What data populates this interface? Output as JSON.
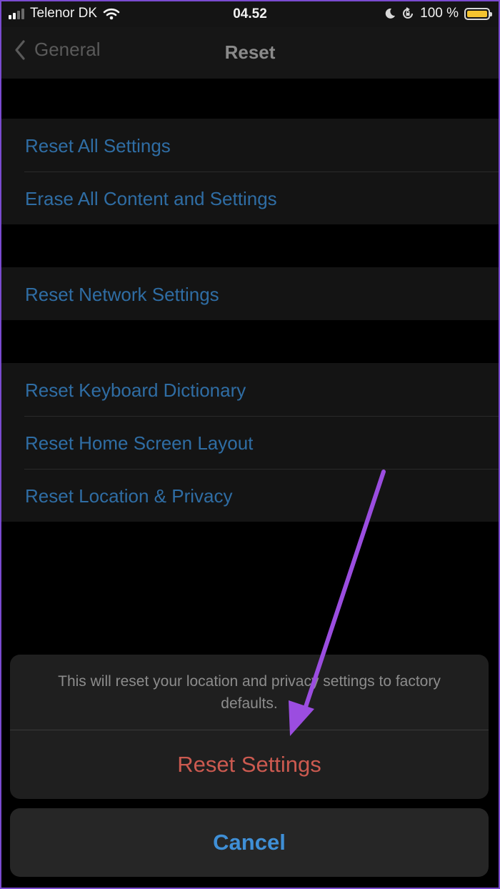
{
  "status_bar": {
    "carrier": "Telenor DK",
    "time": "04.52",
    "battery_text": "100 %"
  },
  "nav": {
    "back_label": "General",
    "title": "Reset"
  },
  "groups": [
    [
      "Reset All Settings",
      "Erase All Content and Settings"
    ],
    [
      "Reset Network Settings"
    ],
    [
      "Reset Keyboard Dictionary",
      "Reset Home Screen Layout",
      "Reset Location & Privacy"
    ]
  ],
  "action_sheet": {
    "message": "This will reset your location and privacy settings to factory defaults.",
    "action_label": "Reset Settings",
    "cancel_label": "Cancel"
  },
  "colors": {
    "link_blue": "#2f6da4",
    "destructive_red": "#cc5a50",
    "cancel_blue": "#3f8fd6",
    "annotation_arrow": "#9b4de0",
    "frame": "#7a4bd0"
  },
  "icons": [
    "signal-icon",
    "wifi-icon",
    "moon-icon",
    "orientation-lock-icon",
    "battery-icon",
    "chevron-left-icon",
    "annotation-arrow"
  ]
}
